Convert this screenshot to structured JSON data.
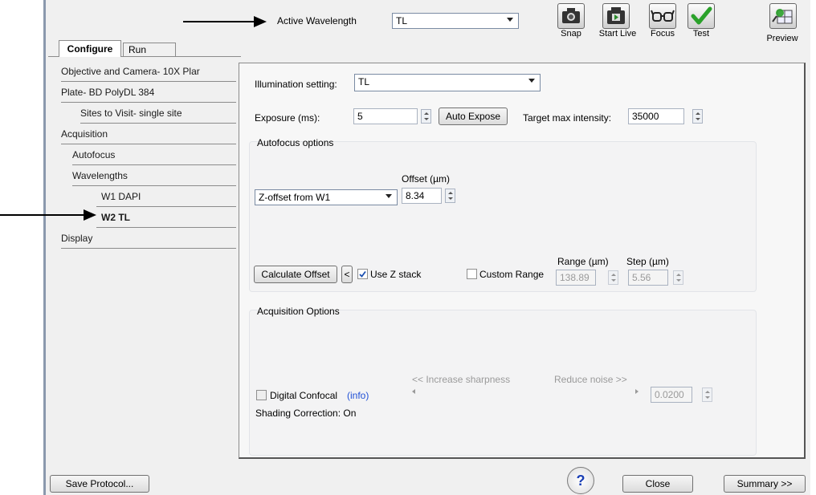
{
  "header": {
    "active_wavelength_label": "Active Wavelength",
    "active_wavelength_value": "TL"
  },
  "toolbar": {
    "snap": "Snap",
    "start_live": "Start Live",
    "focus": "Focus",
    "test": "Test",
    "preview": "Preview"
  },
  "tabs": [
    {
      "label": "Configure",
      "selected": true
    },
    {
      "label": "Run",
      "selected": false
    }
  ],
  "nav": {
    "items": [
      {
        "label": "Objective and Camera- 10X Plar"
      },
      {
        "label": "Plate- BD PolyDL 384"
      },
      {
        "label": "Sites to Visit- single site"
      },
      {
        "label": "Acquisition"
      },
      {
        "label": "Autofocus"
      },
      {
        "label": "Wavelengths"
      },
      {
        "label": "W1 DAPI"
      },
      {
        "label": "W2 TL"
      },
      {
        "label": "Display"
      }
    ]
  },
  "settings": {
    "illumination_label": "Illumination setting:",
    "illumination_value": "TL",
    "exposure_label": "Exposure (ms):",
    "exposure_value": "5",
    "auto_expose": "Auto Expose",
    "target_label": "Target max intensity:",
    "target_value": "35000"
  },
  "autofocus": {
    "title": "Autofocus options",
    "offset_label": "Offset (µm)",
    "mode_value": "Z-offset from W1",
    "offset_value": "8.34",
    "calc_offset": "Calculate Offset",
    "lt_button": "<",
    "use_zstack": "Use Z stack",
    "custom_range": "Custom Range",
    "range_label": "Range (µm)",
    "step_label": "Step (µm)",
    "range_value": "138.89",
    "step_value": "5.56"
  },
  "acquisition": {
    "title": "Acquisition Options",
    "digital_confocal": "Digital Confocal",
    "info": "(info)",
    "increase_sharpness": "<< Increase sharpness",
    "reduce_noise": "Reduce noise >>",
    "confocal_value": "0.0200",
    "shading": "Shading Correction: On"
  },
  "footer": {
    "save_protocol": "Save Protocol...",
    "help": "?",
    "close": "Close",
    "summary": "Summary >>"
  },
  "colors": {
    "window_bg": "#f0f0f0",
    "link": "#1f4fd6",
    "check_green": "#2aa12a"
  }
}
